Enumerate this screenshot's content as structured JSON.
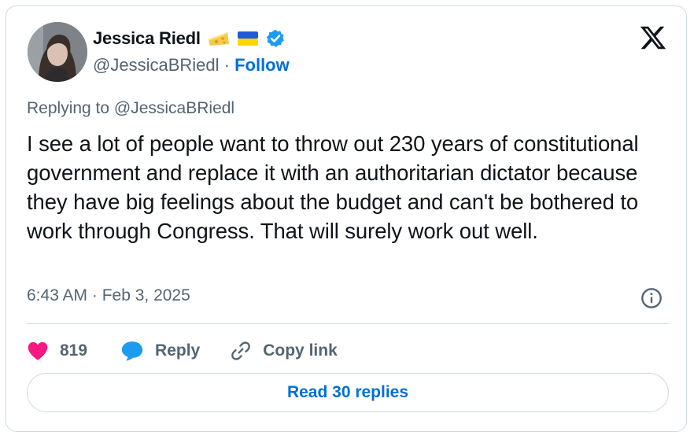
{
  "author": {
    "name": "Jessica Riedl",
    "handle": "@JessicaBRiedl",
    "separator": "·",
    "follow_label": "Follow",
    "emojis": [
      "cheese-emoji",
      "ukraine-flag-emoji"
    ],
    "verified": true
  },
  "tweet": {
    "replying_to": "Replying to @JessicaBRiedl",
    "text": "I see a lot of people want to throw out 230 years of constitutional government and replace it with an authoritarian dictator because they have big feelings about the budget and can't be bothered to work through Congress. That will surely work out well.",
    "timestamp": "6:43 AM · Feb 3, 2025"
  },
  "actions": {
    "like_count": "819",
    "reply_label": "Reply",
    "copy_link_label": "Copy link"
  },
  "footer": {
    "read_replies_label": "Read 30 replies"
  },
  "colors": {
    "link": "#006fd6",
    "verified": "#1d9bf0",
    "heart": "#f91880",
    "secondary_text": "#536471",
    "border": "#cfd9de"
  }
}
